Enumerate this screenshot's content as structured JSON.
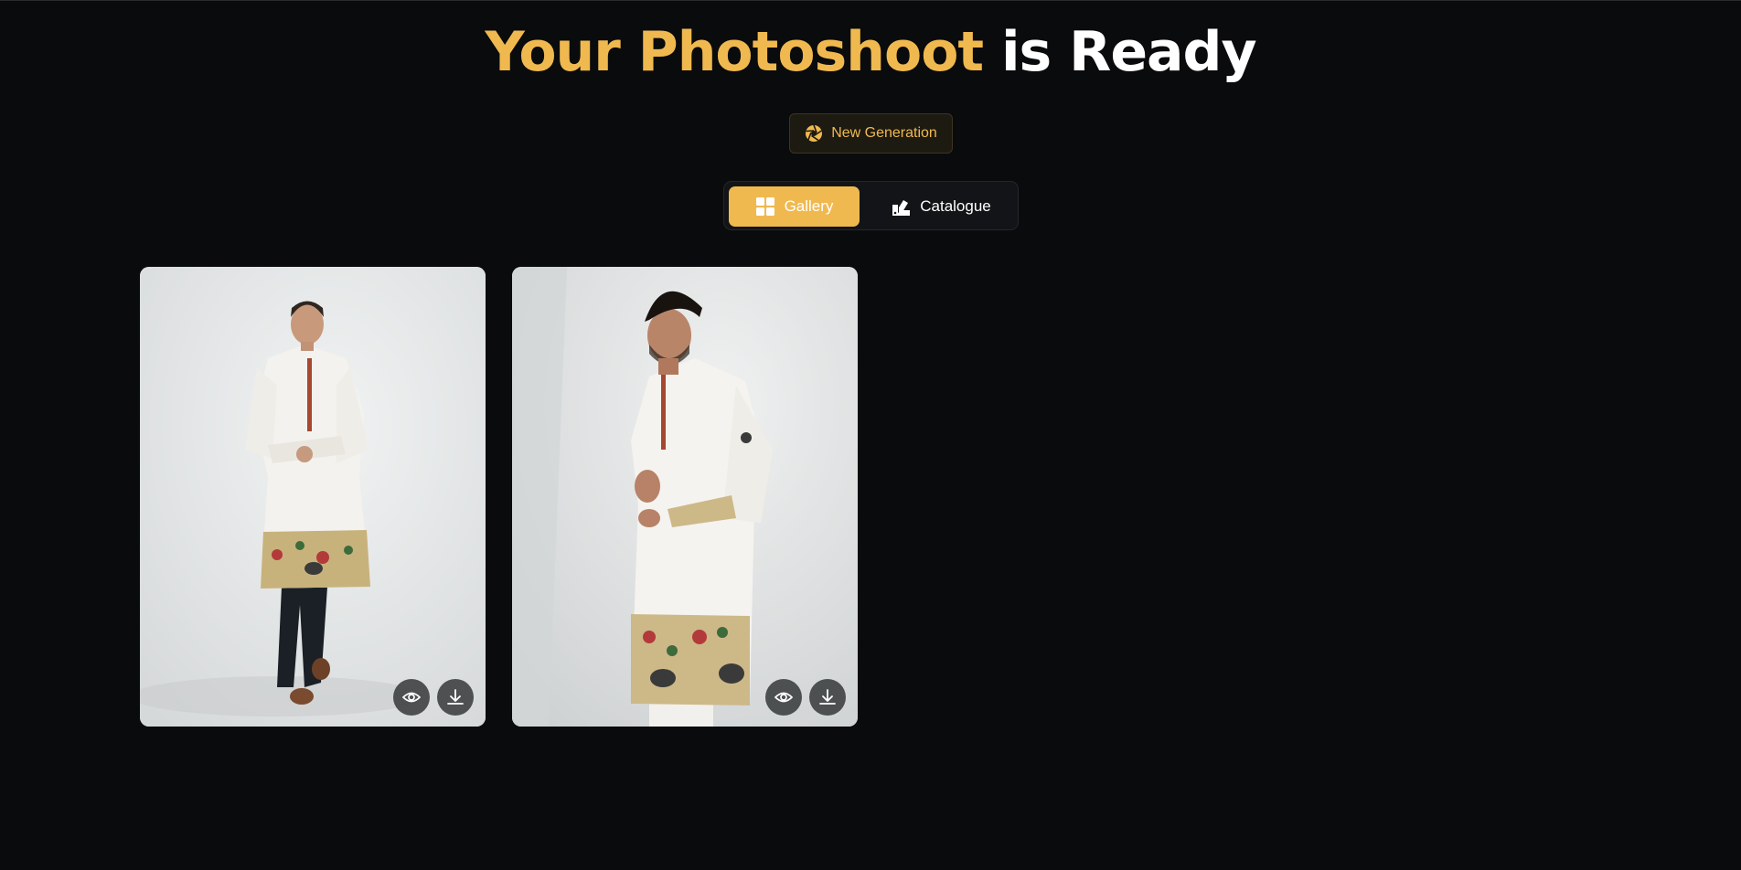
{
  "header": {
    "title_accent": "Your Photoshoot",
    "title_rest": "is Ready"
  },
  "actions": {
    "new_generation_label": "New Generation"
  },
  "view_toggle": {
    "tabs": [
      {
        "label": "Gallery",
        "icon": "grid-icon",
        "active": true
      },
      {
        "label": "Catalogue",
        "icon": "catalogue-icon",
        "active": false
      }
    ]
  },
  "gallery": {
    "items": [
      {
        "subject": "model in white embroidered kurta, front view",
        "actions": [
          "eye-icon",
          "download-icon"
        ]
      },
      {
        "subject": "model in white embroidered kurta, three-quarter view",
        "actions": [
          "eye-icon",
          "download-icon"
        ]
      }
    ]
  },
  "colors": {
    "background": "#0a0b0d",
    "accent": "#f0b94f",
    "text": "#ffffff"
  }
}
